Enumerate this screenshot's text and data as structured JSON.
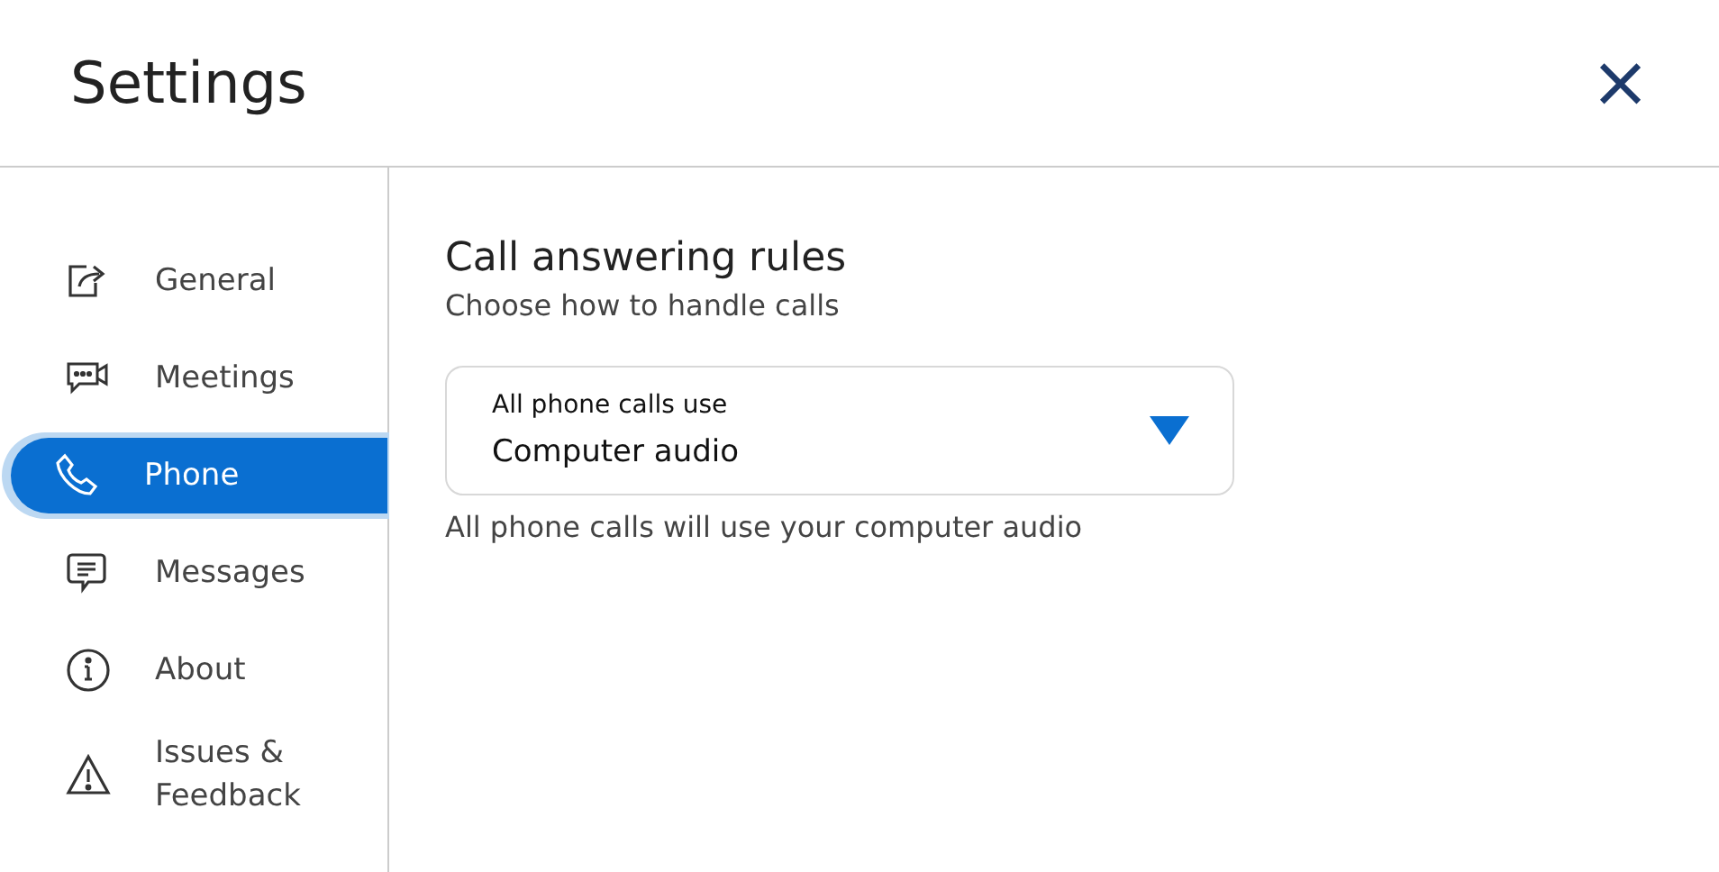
{
  "window": {
    "title": "Settings",
    "close": "×"
  },
  "sidebar": {
    "items": [
      {
        "label": "General",
        "kind": "general",
        "selected": false
      },
      {
        "label": "Meetings",
        "kind": "meetings",
        "selected": false
      },
      {
        "label": "Phone",
        "kind": "phone",
        "selected": true
      },
      {
        "label": "Messages",
        "kind": "messages",
        "selected": false
      },
      {
        "label": "About",
        "kind": "about",
        "selected": false
      },
      {
        "label": "Issues &\nFeedback",
        "kind": "issues",
        "selected": false
      }
    ]
  },
  "content": {
    "title": "Call answering rules",
    "subtitle": "Choose how to handle calls",
    "dropdown": {
      "label": "All phone calls use",
      "value": "Computer audio"
    },
    "helper": "All phone calls will use your computer audio"
  }
}
